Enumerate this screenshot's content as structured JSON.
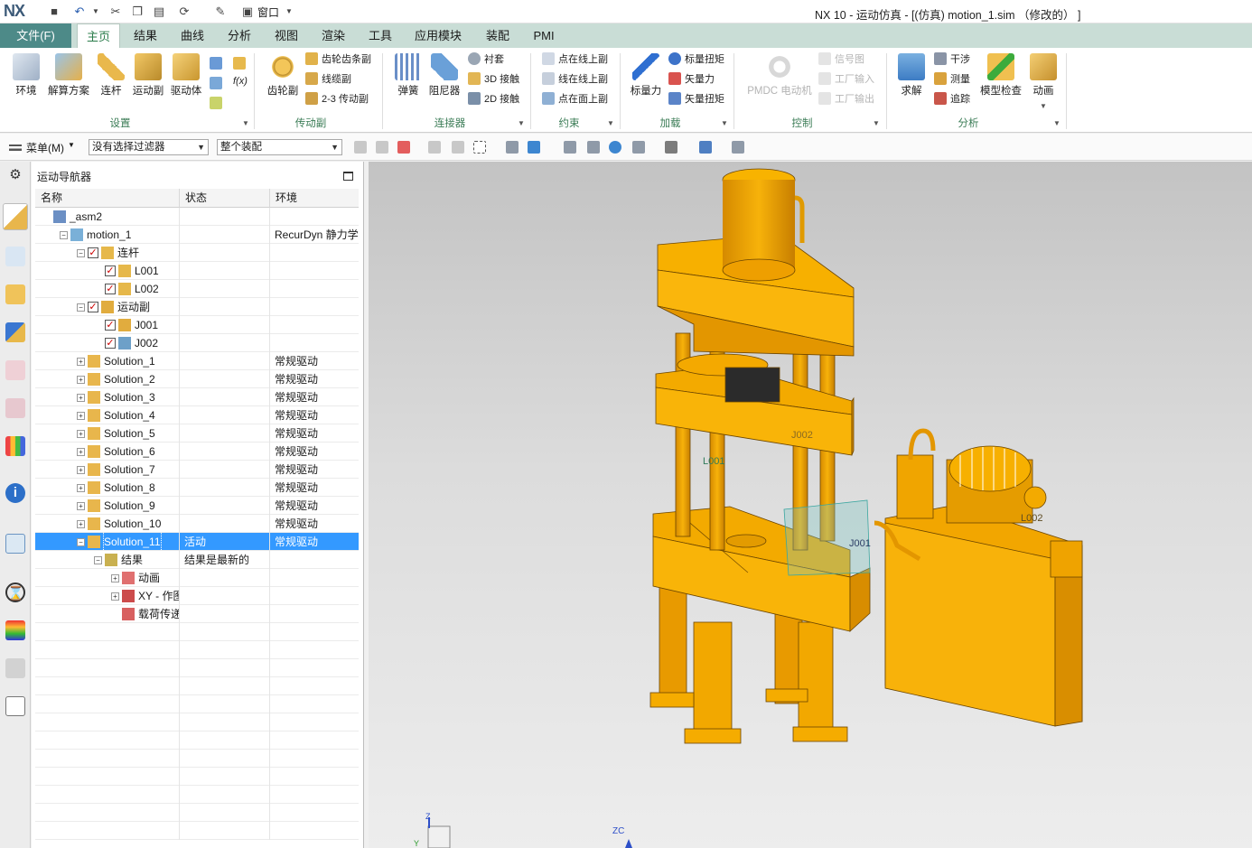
{
  "title_bar": {
    "logo": "NX",
    "window_menu": "窗口",
    "title": "NX 10 - 运动仿真 - [(仿真) motion_1.sim （修改的） ]"
  },
  "tabs": {
    "file": "文件(F)",
    "items": [
      "主页",
      "结果",
      "曲线",
      "分析",
      "视图",
      "渲染",
      "工具",
      "应用模块",
      "装配",
      "PMI"
    ],
    "active": "主页"
  },
  "ribbon": {
    "setup": {
      "label": "设置",
      "buttons": [
        "环境",
        "解算方案",
        "连杆",
        "运动副",
        "驱动体"
      ]
    },
    "drive": {
      "label": "传动副",
      "big": "齿轮副",
      "small": [
        "齿轮齿条副",
        "线缆副",
        "2-3 传动副"
      ]
    },
    "connector": {
      "label": "连接器",
      "big": [
        "弹簧",
        "阻尼器"
      ],
      "small": [
        "衬套",
        "3D 接触",
        "2D 接触"
      ]
    },
    "constraint": {
      "label": "约束",
      "small": [
        "点在线上副",
        "线在线上副",
        "点在面上副"
      ]
    },
    "load": {
      "label": "加载",
      "big": "标量力",
      "small": [
        "标量扭矩",
        "矢量力",
        "矢量扭矩"
      ]
    },
    "control": {
      "label": "控制",
      "big": "PMDC 电动机",
      "small": [
        "信号图",
        "工厂输入",
        "工厂输出"
      ]
    },
    "analysis": {
      "label": "分析",
      "big": [
        "求解",
        "模型检查",
        "动画"
      ],
      "small": [
        "干涉",
        "测量",
        "追踪"
      ]
    }
  },
  "toolbar": {
    "menu": "菜单(M)",
    "filter": "没有选择过滤器",
    "scope": "整个装配"
  },
  "navigator": {
    "title": "运动导航器",
    "columns": [
      "名称",
      "状态",
      "环境"
    ],
    "rows": [
      {
        "name": "_asm2",
        "status": "",
        "env": ""
      },
      {
        "name": "motion_1",
        "status": "",
        "env": "RecurDyn 静力学"
      },
      {
        "name": "连杆",
        "status": "",
        "env": ""
      },
      {
        "name": "L001",
        "status": "",
        "env": ""
      },
      {
        "name": "L002",
        "status": "",
        "env": ""
      },
      {
        "name": "运动副",
        "status": "",
        "env": ""
      },
      {
        "name": "J001",
        "status": "",
        "env": ""
      },
      {
        "name": "J002",
        "status": "",
        "env": ""
      },
      {
        "name": "Solution_1",
        "status": "",
        "env": "常规驱动"
      },
      {
        "name": "Solution_2",
        "status": "",
        "env": "常规驱动"
      },
      {
        "name": "Solution_3",
        "status": "",
        "env": "常规驱动"
      },
      {
        "name": "Solution_4",
        "status": "",
        "env": "常规驱动"
      },
      {
        "name": "Solution_5",
        "status": "",
        "env": "常规驱动"
      },
      {
        "name": "Solution_6",
        "status": "",
        "env": "常规驱动"
      },
      {
        "name": "Solution_7",
        "status": "",
        "env": "常规驱动"
      },
      {
        "name": "Solution_8",
        "status": "",
        "env": "常规驱动"
      },
      {
        "name": "Solution_9",
        "status": "",
        "env": "常规驱动"
      },
      {
        "name": "Solution_10",
        "status": "",
        "env": "常规驱动"
      },
      {
        "name": "Solution_11",
        "status": "活动",
        "env": "常规驱动"
      },
      {
        "name": "结果",
        "status": "结果是最新的",
        "env": ""
      },
      {
        "name": "动画",
        "status": "",
        "env": ""
      },
      {
        "name": "XY - 作图",
        "status": "",
        "env": ""
      },
      {
        "name": "载荷传递",
        "status": "",
        "env": ""
      }
    ]
  },
  "viewport": {
    "labels": [
      "J002",
      "J001",
      "L001",
      "L002",
      "J001"
    ],
    "axis_z": "Z",
    "axis_y": "Y",
    "axis_zc": "ZC"
  },
  "colors": {
    "accent": "#2a7c4a",
    "file_tab": "#4d8a88",
    "model": "#f0a400",
    "selection": "#3399ff"
  }
}
